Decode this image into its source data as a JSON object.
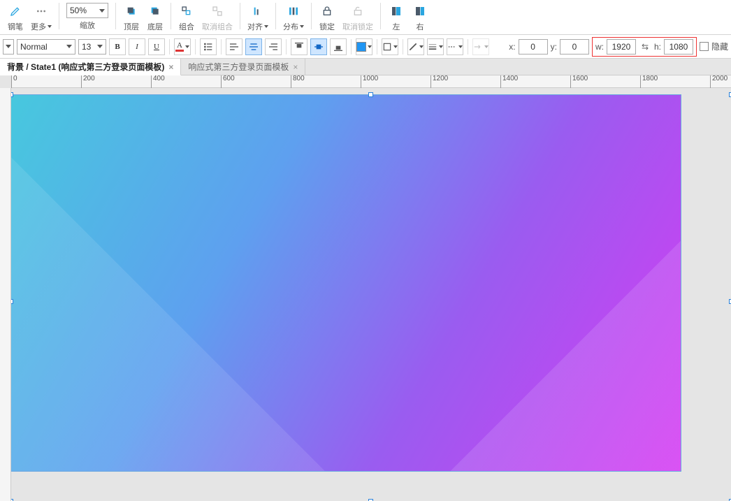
{
  "ribbon": {
    "pen": "钢笔",
    "more": "更多",
    "zoom_value": "50%",
    "zoom_label": "缩放",
    "front": "顶层",
    "back": "底层",
    "group": "组合",
    "ungroup": "取消组合",
    "align": "对齐",
    "distribute": "分布",
    "lock": "锁定",
    "unlock": "取消锁定",
    "left": "左",
    "right": "右"
  },
  "toolbar2": {
    "font_weight": "Normal",
    "font_size": "13",
    "x_label": "x:",
    "y_label": "y:",
    "w_label": "w:",
    "h_label": "h:",
    "x_value": "0",
    "y_value": "0",
    "w_value": "1920",
    "h_value": "1080",
    "hidden_label": "隐藏"
  },
  "tabs": {
    "active": "背景 / State1 (响应式第三方登录页面模板)",
    "second": "响应式第三方登录页面模板"
  },
  "ruler_ticks": [
    "0",
    "200",
    "400",
    "600",
    "800",
    "1000",
    "1200",
    "1400",
    "1600",
    "1800",
    "2000"
  ]
}
